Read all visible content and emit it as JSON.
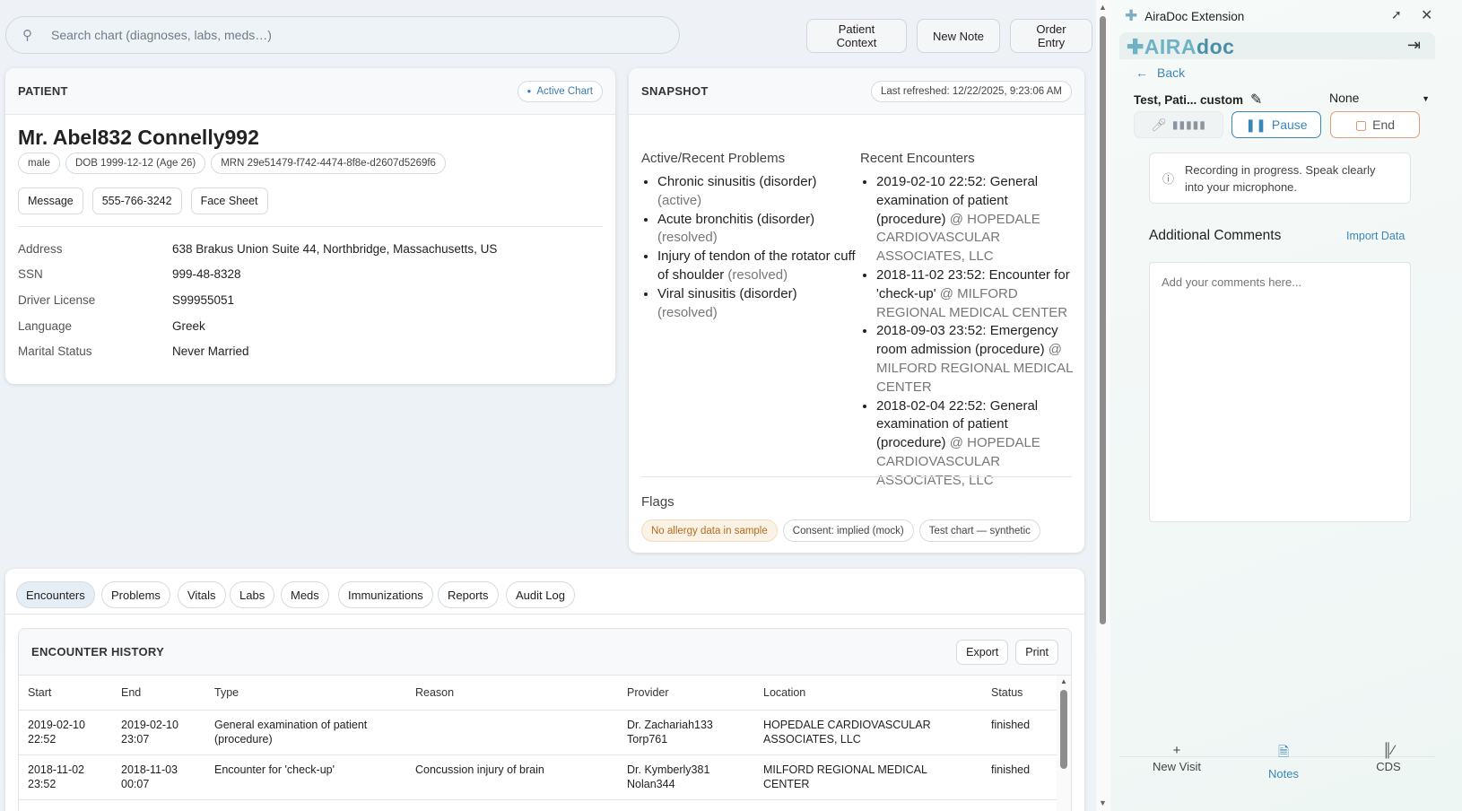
{
  "search": {
    "placeholder": "Search chart (diagnoses, labs, meds…)"
  },
  "header_buttons": {
    "patient_context": "Patient Context",
    "new_note": "New Note",
    "order_entry": "Order Entry"
  },
  "patient": {
    "section_title": "PATIENT",
    "badge": "Active Chart",
    "name": "Mr. Abel832 Connelly992",
    "sex": "male",
    "dob": "DOB 1999-12-12 (Age 26)",
    "mrn": "MRN 29e51479-f742-4474-8f8e-d2607d5269f6",
    "actions": {
      "message": "Message",
      "phone": "555-766-3242",
      "face_sheet": "Face Sheet"
    },
    "details": [
      {
        "key": "Address",
        "value": "638 Brakus Union Suite 44, Northbridge, Massachusetts, US"
      },
      {
        "key": "SSN",
        "value": "999-48-8328"
      },
      {
        "key": "Driver License",
        "value": "S99955051"
      },
      {
        "key": "Language",
        "value": "Greek"
      },
      {
        "key": "Marital Status",
        "value": "Never Married"
      }
    ]
  },
  "snapshot": {
    "section_title": "SNAPSHOT",
    "last_refreshed": "Last refreshed: 12/22/2025, 9:23:06 AM",
    "problems_heading": "Active/Recent Problems",
    "problems": [
      {
        "name": "Chronic sinusitis (disorder)",
        "status": "(active)"
      },
      {
        "name": "Acute bronchitis (disorder)",
        "status": "(resolved)"
      },
      {
        "name": "Injury of tendon of the rotator cuff of shoulder",
        "status": "(resolved)"
      },
      {
        "name": "Viral sinusitis (disorder)",
        "status": "(resolved)"
      }
    ],
    "encounters_heading": "Recent Encounters",
    "encounters": [
      {
        "text": "2019-02-10 22:52: General examination of patient (procedure)",
        "at": "@ HOPEDALE CARDIOVASCULAR ASSOCIATES, LLC"
      },
      {
        "text": "2018-11-02 23:52: Encounter for 'check-up'",
        "at": "@ MILFORD REGIONAL MEDICAL CENTER"
      },
      {
        "text": "2018-09-03 23:52: Emergency room admission (procedure)",
        "at": "@ MILFORD REGIONAL MEDICAL CENTER"
      },
      {
        "text": "2018-02-04 22:52: General examination of patient (procedure)",
        "at": "@ HOPEDALE CARDIOVASCULAR ASSOCIATES, LLC"
      }
    ],
    "flags_heading": "Flags",
    "flags": [
      "No allergy data in sample",
      "Consent: implied (mock)",
      "Test chart — synthetic"
    ]
  },
  "tabs": [
    "Encounters",
    "Problems",
    "Vitals",
    "Labs",
    "Meds",
    "Immunizations",
    "Reports",
    "Audit Log"
  ],
  "encounter_history": {
    "title": "ENCOUNTER HISTORY",
    "export": "Export",
    "print": "Print",
    "columns": [
      "Start",
      "End",
      "Type",
      "Reason",
      "Provider",
      "Location",
      "Status"
    ],
    "rows": [
      [
        "2019-02-10 22:52",
        "2019-02-10 23:07",
        "General examination of patient (procedure)",
        "",
        "Dr. Zachariah133 Torp761",
        "HOPEDALE CARDIOVASCULAR ASSOCIATES, LLC",
        "finished"
      ],
      [
        "2018-11-02 23:52",
        "2018-11-03 00:07",
        "Encounter for 'check-up'",
        "Concussion injury of brain",
        "Dr. Kymberly381 Nolan344",
        "MILFORD REGIONAL MEDICAL CENTER",
        "finished"
      ]
    ]
  },
  "extension": {
    "title": "AiraDoc Extension",
    "brand_part1": "AIRA",
    "brand_part2": "doc",
    "back": "Back",
    "patient_label": "Test, Pati... custom",
    "template_select": "None",
    "pause": "Pause",
    "end": "End",
    "recording_msg": "Recording in progress. Speak clearly into your microphone.",
    "comments_heading": "Additional Comments",
    "import_data": "Import Data",
    "comments_placeholder": "Add your comments here...",
    "nav": [
      "New Visit",
      "Notes",
      "CDS"
    ],
    "accent": "#3a86b8"
  }
}
